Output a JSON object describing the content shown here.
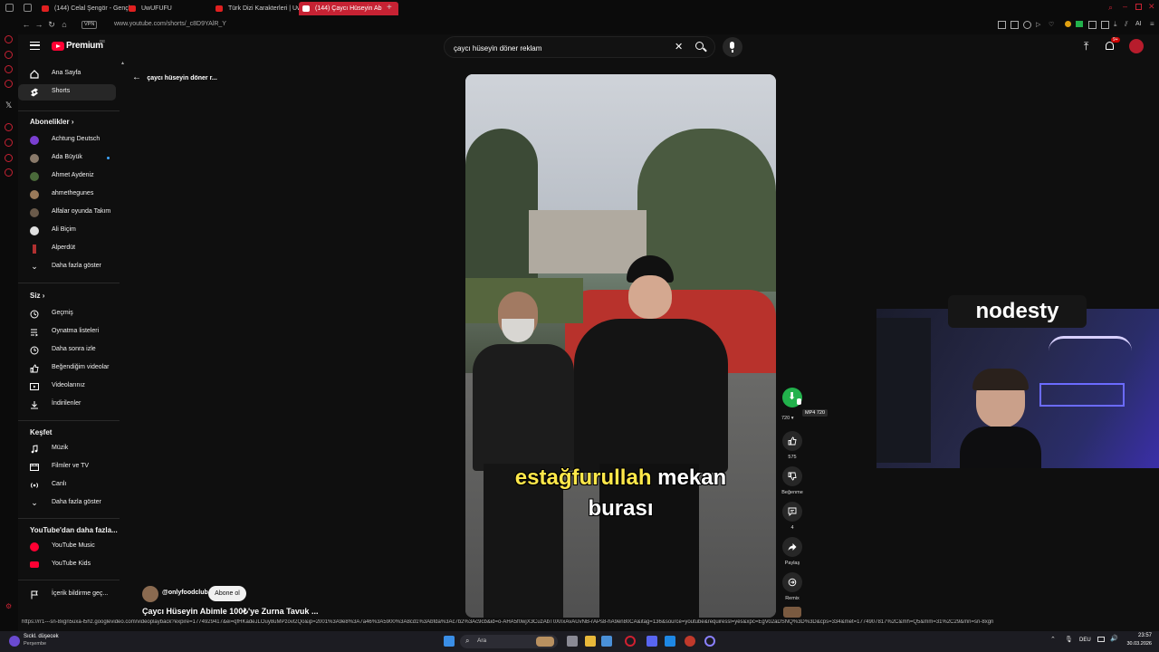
{
  "browser": {
    "tabs": [
      {
        "label": "(144) Celal Şengör - Gençl"
      },
      {
        "label": "UwUFUFU"
      },
      {
        "label": "Türk Dizi Karakterleri | Uw"
      },
      {
        "label": "(144) Çaycı Hüseyin Ab"
      }
    ],
    "vpn_label": "VPN",
    "url": "www.youtube.com/shorts/_c8D9YAlR_Y",
    "ai_label": "AI"
  },
  "youtube": {
    "brand": "Premium",
    "brand_region": "DE",
    "search_value": "çaycı hüseyin döner reklam",
    "notification_count": "9+",
    "back_label": "çaycı hüseyin döner r...",
    "sidebar": {
      "top": [
        {
          "label": "Ana Sayfa",
          "icon": "home-icon"
        },
        {
          "label": "Shorts",
          "icon": "shorts-icon",
          "active": true
        }
      ],
      "subscriptions_heading": "Abonelikler",
      "subscriptions": [
        {
          "label": "Achtung Deutsch",
          "color": "#7a3fd1"
        },
        {
          "label": "Ada Büyük",
          "color": "#8a7a6a"
        },
        {
          "label": "Ahmet Aydeniz",
          "color": "#4a6a3a"
        },
        {
          "label": "ahmethegunes",
          "color": "#9a7a5a"
        },
        {
          "label": "Alfalar oyunda Takım",
          "color": "#6a5a4a"
        },
        {
          "label": "Ali Biçim",
          "color": "#e0e0e0"
        },
        {
          "label": "Alperdüt",
          "color": "#b03030"
        }
      ],
      "show_more": "Daha fazla göster",
      "you_heading": "Siz",
      "you_items": [
        {
          "label": "Geçmiş",
          "icon": "history-icon"
        },
        {
          "label": "Oynatma listeleri",
          "icon": "playlist-icon"
        },
        {
          "label": "Daha sonra izle",
          "icon": "clock-icon"
        },
        {
          "label": "Beğendiğim videolar",
          "icon": "like-icon"
        },
        {
          "label": "Videolarınız",
          "icon": "video-icon"
        },
        {
          "label": "İndirilenler",
          "icon": "download-icon"
        }
      ],
      "explore_heading": "Keşfet",
      "explore_items": [
        {
          "label": "Müzik",
          "icon": "music-icon"
        },
        {
          "label": "Filmler ve TV",
          "icon": "film-icon"
        },
        {
          "label": "Canlı",
          "icon": "live-icon"
        }
      ],
      "explore_show_more": "Daha fazla göster",
      "more_heading": "YouTube'dan daha fazla...",
      "more_items": [
        {
          "label": "YouTube Music",
          "icon": "yt-music-icon"
        },
        {
          "label": "YouTube Kids",
          "icon": "yt-kids-icon"
        }
      ],
      "report_label": "İçerik bildirme geç..."
    },
    "short": {
      "caption_line1_a": "estağfurullah",
      "caption_line1_b": " mekan",
      "caption_line2": "burası",
      "channel": "@onlyfoodclub",
      "subscribe_label": "Abone ol",
      "title": "Çaycı Hüseyin Abimle 100₺'ye Zurna Tavuk ..."
    },
    "actions": {
      "download_quality": "720",
      "download_tooltip": "MP4 720",
      "likes": "575",
      "dislike_label": "Beğenme",
      "comments": "4",
      "share_label": "Paylaş",
      "remix_label": "Remix"
    }
  },
  "overlay": {
    "logo_text": "nodesty"
  },
  "status_url": "https://rr1---sn-8xgn5uxa-l5hz.googlevideo.com/videoplayback?expire=1774929417&ei=qfHKadeJLOuy8uMPzovl2Qo&ip=2001%3A9e8%3A7a46%3A5900%3A8cd1%3Abfda%3Ac7b2%3Ac9cb&id=o-AHA5f0wjX3CuzAbT0XrixAvAUvNB-rAPs8-hA9en80CA&itag=136&source=youtube&requiressl=yes&xpc=EgVo2aDSNQ%3D%3D&cps=334&met=1774907817%2C&mh=Q5&mm=31%2C29&mn=sn-8xgn",
  "taskbar": {
    "weather": "Sıckl. düşecek",
    "weather_day": "Perşembe",
    "search_label": "Ara",
    "lang": "DEU",
    "time": "23:57",
    "date": "30.03.2026"
  },
  "colors": {
    "youtube_red": "#ff0033",
    "active_tab": "#c62233",
    "download_green": "#22b14c"
  }
}
